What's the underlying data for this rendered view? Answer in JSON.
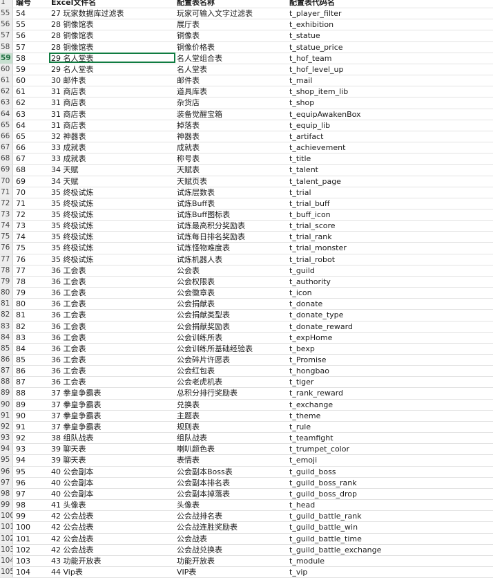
{
  "header": {
    "row_num": "1",
    "id": "编号",
    "file": "Excel文件名",
    "name": "配置表名称",
    "code": "配置表代码名"
  },
  "selected_row": "59",
  "rows": [
    {
      "n": "55",
      "id": "54",
      "file": "27 玩家数据库过滤表",
      "name": "玩家可输入文字过滤表",
      "code": "t_player_filter"
    },
    {
      "n": "56",
      "id": "55",
      "file": "28 铜像馆表",
      "name": "展厅表",
      "code": "t_exhibition"
    },
    {
      "n": "57",
      "id": "56",
      "file": "28 铜像馆表",
      "name": "铜像表",
      "code": "t_statue"
    },
    {
      "n": "58",
      "id": "57",
      "file": "28 铜像馆表",
      "name": "铜像价格表",
      "code": "t_statue_price"
    },
    {
      "n": "59",
      "id": "58",
      "file": "29 名人堂表",
      "name": "名人堂组合表",
      "code": "t_hof_team"
    },
    {
      "n": "60",
      "id": "59",
      "file": "29 名人堂表",
      "name": "名人堂表",
      "code": "t_hof_level_up"
    },
    {
      "n": "61",
      "id": "60",
      "file": "30 邮件表",
      "name": "邮件表",
      "code": "t_mail"
    },
    {
      "n": "62",
      "id": "61",
      "file": "31 商店表",
      "name": "道具库表",
      "code": "t_shop_item_lib"
    },
    {
      "n": "63",
      "id": "62",
      "file": "31 商店表",
      "name": "杂货店",
      "code": "t_shop"
    },
    {
      "n": "64",
      "id": "63",
      "file": "31 商店表",
      "name": "装备觉醒宝箱",
      "code": "t_equipAwakenBox"
    },
    {
      "n": "65",
      "id": "64",
      "file": "31 商店表",
      "name": "掉落表",
      "code": "t_equip_lib"
    },
    {
      "n": "66",
      "id": "65",
      "file": "32 神器表",
      "name": "神器表",
      "code": "t_artifact"
    },
    {
      "n": "67",
      "id": "66",
      "file": "33 成就表",
      "name": "成就表",
      "code": "t_achievement"
    },
    {
      "n": "68",
      "id": "67",
      "file": "33 成就表",
      "name": "称号表",
      "code": "t_title"
    },
    {
      "n": "69",
      "id": "68",
      "file": "34 天赋",
      "name": "天赋表",
      "code": "t_talent"
    },
    {
      "n": "70",
      "id": "69",
      "file": "34 天赋",
      "name": "天赋页表",
      "code": "t_talent_page"
    },
    {
      "n": "71",
      "id": "70",
      "file": "35 终极试炼",
      "name": "试炼层数表",
      "code": "t_trial"
    },
    {
      "n": "72",
      "id": "71",
      "file": "35 终极试炼",
      "name": "试炼Buff表",
      "code": "t_trial_buff"
    },
    {
      "n": "73",
      "id": "72",
      "file": "35 终极试炼",
      "name": "试炼Buff图标表",
      "code": "t_buff_icon"
    },
    {
      "n": "74",
      "id": "73",
      "file": "35 终极试炼",
      "name": "试炼最高积分奖励表",
      "code": "t_trial_score"
    },
    {
      "n": "75",
      "id": "74",
      "file": "35 终极试炼",
      "name": "试炼每日排名奖励表",
      "code": "t_trial_rank"
    },
    {
      "n": "76",
      "id": "75",
      "file": "35 终极试炼",
      "name": "试炼怪物难度表",
      "code": "t_trial_monster"
    },
    {
      "n": "77",
      "id": "76",
      "file": "35 终极试炼",
      "name": "试炼机器人表",
      "code": "t_trial_robot"
    },
    {
      "n": "78",
      "id": "77",
      "file": "36 工会表",
      "name": "公会表",
      "code": "t_guild"
    },
    {
      "n": "79",
      "id": "78",
      "file": "36 工会表",
      "name": "公会权限表",
      "code": "t_authority"
    },
    {
      "n": "80",
      "id": "79",
      "file": "36 工会表",
      "name": "公会徽章表",
      "code": "t_icon"
    },
    {
      "n": "81",
      "id": "80",
      "file": "36 工会表",
      "name": "公会捐献表",
      "code": "t_donate"
    },
    {
      "n": "82",
      "id": "81",
      "file": "36 工会表",
      "name": "公会捐献类型表",
      "code": "t_donate_type"
    },
    {
      "n": "83",
      "id": "82",
      "file": "36 工会表",
      "name": "公会捐献奖励表",
      "code": "t_donate_reward"
    },
    {
      "n": "84",
      "id": "83",
      "file": "36 工会表",
      "name": "公会训练所表",
      "code": "t_expHome"
    },
    {
      "n": "85",
      "id": "84",
      "file": "36 工会表",
      "name": "公会训练所基础经验表",
      "code": "t_bexp"
    },
    {
      "n": "86",
      "id": "85",
      "file": "36 工会表",
      "name": "公会碎片许愿表",
      "code": "t_Promise"
    },
    {
      "n": "87",
      "id": "86",
      "file": "36 工会表",
      "name": "公会红包表",
      "code": "t_hongbao"
    },
    {
      "n": "88",
      "id": "87",
      "file": "36 工会表",
      "name": "公会老虎机表",
      "code": "t_tiger"
    },
    {
      "n": "89",
      "id": "88",
      "file": "37 拳皇争霸表",
      "name": "总积分排行奖励表",
      "code": "t_rank_reward"
    },
    {
      "n": "90",
      "id": "89",
      "file": "37 拳皇争霸表",
      "name": "兑换表",
      "code": "t_exchange"
    },
    {
      "n": "91",
      "id": "90",
      "file": "37 拳皇争霸表",
      "name": "主题表",
      "code": "t_theme"
    },
    {
      "n": "92",
      "id": "91",
      "file": "37 拳皇争霸表",
      "name": "规则表",
      "code": "t_rule"
    },
    {
      "n": "93",
      "id": "92",
      "file": "38 组队战表",
      "name": "组队战表",
      "code": "t_teamfight"
    },
    {
      "n": "94",
      "id": "93",
      "file": "39 聊天表",
      "name": "喇叭颜色表",
      "code": "t_trumpet_color"
    },
    {
      "n": "95",
      "id": "94",
      "file": "39 聊天表",
      "name": "表情表",
      "code": "t_emoji"
    },
    {
      "n": "96",
      "id": "95",
      "file": "40 公会副本",
      "name": "公会副本Boss表",
      "code": "t_guild_boss"
    },
    {
      "n": "97",
      "id": "96",
      "file": "40 公会副本",
      "name": "公会副本排名表",
      "code": "t_guild_boss_rank"
    },
    {
      "n": "98",
      "id": "97",
      "file": "40 公会副本",
      "name": "公会副本掉落表",
      "code": "t_guild_boss_drop"
    },
    {
      "n": "99",
      "id": "98",
      "file": "41 头像表",
      "name": "头像表",
      "code": "t_head"
    },
    {
      "n": "100",
      "id": "99",
      "file": "42 公会战表",
      "name": "公会战排名表",
      "code": "t_guild_battle_rank"
    },
    {
      "n": "101",
      "id": "100",
      "file": "42 公会战表",
      "name": "公会战连胜奖励表",
      "code": "t_guild_battle_win"
    },
    {
      "n": "102",
      "id": "101",
      "file": "42 公会战表",
      "name": "公会战表",
      "code": "t_guild_battle_time"
    },
    {
      "n": "103",
      "id": "102",
      "file": "42 公会战表",
      "name": "公会战兑换表",
      "code": "t_guild_battle_exchange"
    },
    {
      "n": "104",
      "id": "103",
      "file": "43 功能开放表",
      "name": "功能开放表",
      "code": "t_module"
    },
    {
      "n": "105",
      "id": "104",
      "file": "44 Vip表",
      "name": "VIP表",
      "code": "t_vip"
    }
  ]
}
